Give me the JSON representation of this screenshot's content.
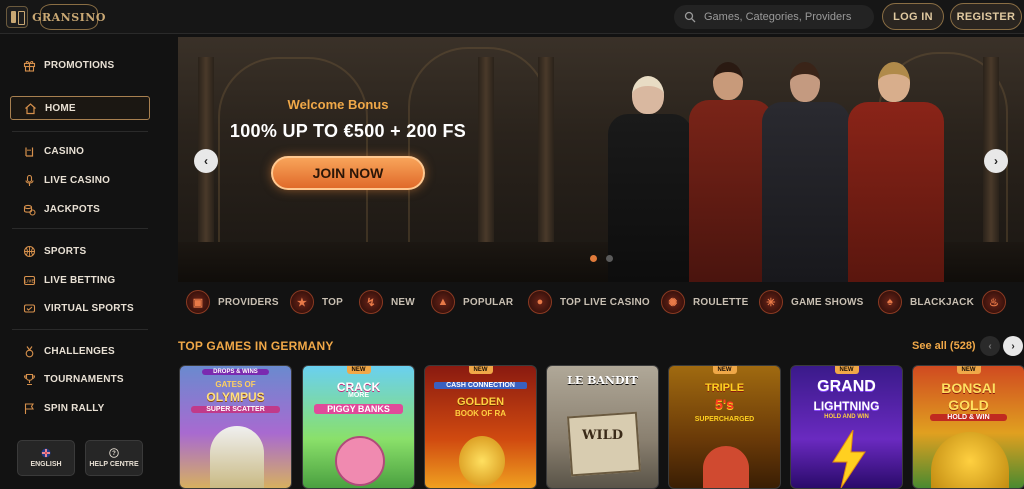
{
  "header": {
    "logo_text": "GRANSINO",
    "search_placeholder": "Games, Categories, Providers",
    "login_label": "LOG IN",
    "register_label": "REGISTER"
  },
  "sidebar": {
    "items": [
      {
        "label": "PROMOTIONS",
        "icon": "gift-icon"
      },
      {
        "label": "HOME",
        "icon": "home-icon",
        "active": true
      },
      {
        "label": "CASINO",
        "icon": "rock-hand-icon"
      },
      {
        "label": "LIVE CASINO",
        "icon": "microphone-icon"
      },
      {
        "label": "JACKPOTS",
        "icon": "coins-icon"
      },
      {
        "label": "SPORTS",
        "icon": "basketball-icon"
      },
      {
        "label": "LIVE BETTING",
        "icon": "live-icon"
      },
      {
        "label": "VIRTUAL SPORTS",
        "icon": "virtual-icon"
      },
      {
        "label": "CHALLENGES",
        "icon": "medal-icon"
      },
      {
        "label": "TOURNAMENTS",
        "icon": "trophy-icon"
      },
      {
        "label": "SPIN RALLY",
        "icon": "flag-icon"
      }
    ],
    "language_label": "ENGLISH",
    "help_label": "HELP CENTRE"
  },
  "banner": {
    "subtitle": "Welcome Bonus",
    "title": "100% UP TO €500 + 200 FS",
    "cta_label": "JOIN NOW",
    "slide_count": 2,
    "active_slide": 1
  },
  "categories": [
    {
      "label": "PROVIDERS",
      "icon": "chip-icon"
    },
    {
      "label": "TOP",
      "icon": "star-icon"
    },
    {
      "label": "NEW",
      "icon": "lightning-icon"
    },
    {
      "label": "POPULAR",
      "icon": "flame-icon"
    },
    {
      "label": "TOP LIVE CASINO",
      "icon": "microphone-icon"
    },
    {
      "label": "ROULETTE",
      "icon": "roulette-icon"
    },
    {
      "label": "GAME SHOWS",
      "icon": "wheel-icon"
    },
    {
      "label": "BLACKJACK",
      "icon": "cards-icon"
    }
  ],
  "games_section": {
    "title": "TOP GAMES IN GERMANY",
    "see_all_label": "See all (528)",
    "games": [
      {
        "name": "Gates of Olympus Super Scatter",
        "top": "DROPS & WINS",
        "line1": "GATES OF",
        "line2": "OLYMPUS",
        "line3": "SUPER SCATTER",
        "new": false
      },
      {
        "name": "Crack More Piggy Banks",
        "line1": "CRACK",
        "line2": "MORE",
        "line3": "PIGGY BANKS",
        "new": true
      },
      {
        "name": "Cash Connection Golden Book of Ra",
        "line1": "CASH CONNECTION",
        "line2": "GOLDEN",
        "line3": "BOOK OF RA",
        "new": true
      },
      {
        "name": "Le Bandit",
        "line1": "LE BANDIT",
        "line2": "WILD",
        "new": false
      },
      {
        "name": "Triple 5's Supercharged",
        "line1": "TRIPLE",
        "line2": "5's",
        "line3": "SUPERCHARGED",
        "new": true
      },
      {
        "name": "Grand Lightning Hold and Win",
        "line1": "GRAND",
        "line2": "LIGHTNING",
        "line3": "HOLD AND WIN",
        "new": true
      },
      {
        "name": "Bonsai Gold Hold & Win",
        "line1": "BONSAI",
        "line2": "GOLD",
        "line3": "HOLD & WIN",
        "new": true
      }
    ],
    "new_badge": "NEW"
  }
}
